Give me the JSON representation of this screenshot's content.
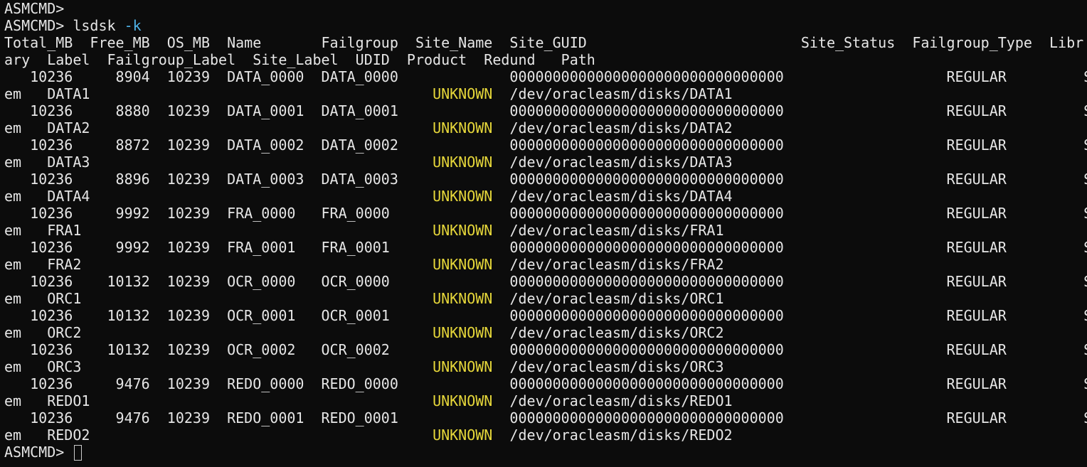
{
  "terminal": {
    "prompt": "ASMCMD>",
    "command": "lsdsk",
    "command_flag": "-k",
    "header_line1": "Total_MB  Free_MB  OS_MB  Name       Failgroup  Site_Name  Site_GUID                         Site_Status  Failgroup_Type  Libr",
    "header_line2": "ary  Label  Failgroup_Label  Site_Label  UDID  Product  Redund   Path",
    "status_word": "UNKNOWN",
    "rows": [
      {
        "line_a": "   10236     8904  10239  DATA_0000  DATA_0000             00000000000000000000000000000000                   REGULAR         Syst",
        "wrap_prefix": "em   DATA1                                        ",
        "path": "/dev/oracleasm/disks/DATA1"
      },
      {
        "line_a": "   10236     8880  10239  DATA_0001  DATA_0001             00000000000000000000000000000000                   REGULAR         Syst",
        "wrap_prefix": "em   DATA2                                        ",
        "path": "/dev/oracleasm/disks/DATA2"
      },
      {
        "line_a": "   10236     8872  10239  DATA_0002  DATA_0002             00000000000000000000000000000000                   REGULAR         Syst",
        "wrap_prefix": "em   DATA3                                        ",
        "path": "/dev/oracleasm/disks/DATA3"
      },
      {
        "line_a": "   10236     8896  10239  DATA_0003  DATA_0003             00000000000000000000000000000000                   REGULAR         Syst",
        "wrap_prefix": "em   DATA4                                        ",
        "path": "/dev/oracleasm/disks/DATA4"
      },
      {
        "line_a": "   10236     9992  10239  FRA_0000   FRA_0000              00000000000000000000000000000000                   REGULAR         Syst",
        "wrap_prefix": "em   FRA1                                         ",
        "path": "/dev/oracleasm/disks/FRA1"
      },
      {
        "line_a": "   10236     9992  10239  FRA_0001   FRA_0001              00000000000000000000000000000000                   REGULAR         Syst",
        "wrap_prefix": "em   FRA2                                         ",
        "path": "/dev/oracleasm/disks/FRA2"
      },
      {
        "line_a": "   10236    10132  10239  OCR_0000   OCR_0000              00000000000000000000000000000000                   REGULAR         Syst",
        "wrap_prefix": "em   ORC1                                         ",
        "path": "/dev/oracleasm/disks/ORC1"
      },
      {
        "line_a": "   10236    10132  10239  OCR_0001   OCR_0001              00000000000000000000000000000000                   REGULAR         Syst",
        "wrap_prefix": "em   ORC2                                         ",
        "path": "/dev/oracleasm/disks/ORC2"
      },
      {
        "line_a": "   10236    10132  10239  OCR_0002   OCR_0002              00000000000000000000000000000000                   REGULAR         Syst",
        "wrap_prefix": "em   ORC3                                         ",
        "path": "/dev/oracleasm/disks/ORC3"
      },
      {
        "line_a": "   10236     9476  10239  REDO_0000  REDO_0000             00000000000000000000000000000000                   REGULAR         Syst",
        "wrap_prefix": "em   REDO1                                        ",
        "path": "/dev/oracleasm/disks/REDO1"
      },
      {
        "line_a": "   10236     9476  10239  REDO_0001  REDO_0001             00000000000000000000000000000000                   REGULAR         Syst",
        "wrap_prefix": "em   REDO2                                        ",
        "path": "/dev/oracleasm/disks/REDO2"
      }
    ]
  }
}
